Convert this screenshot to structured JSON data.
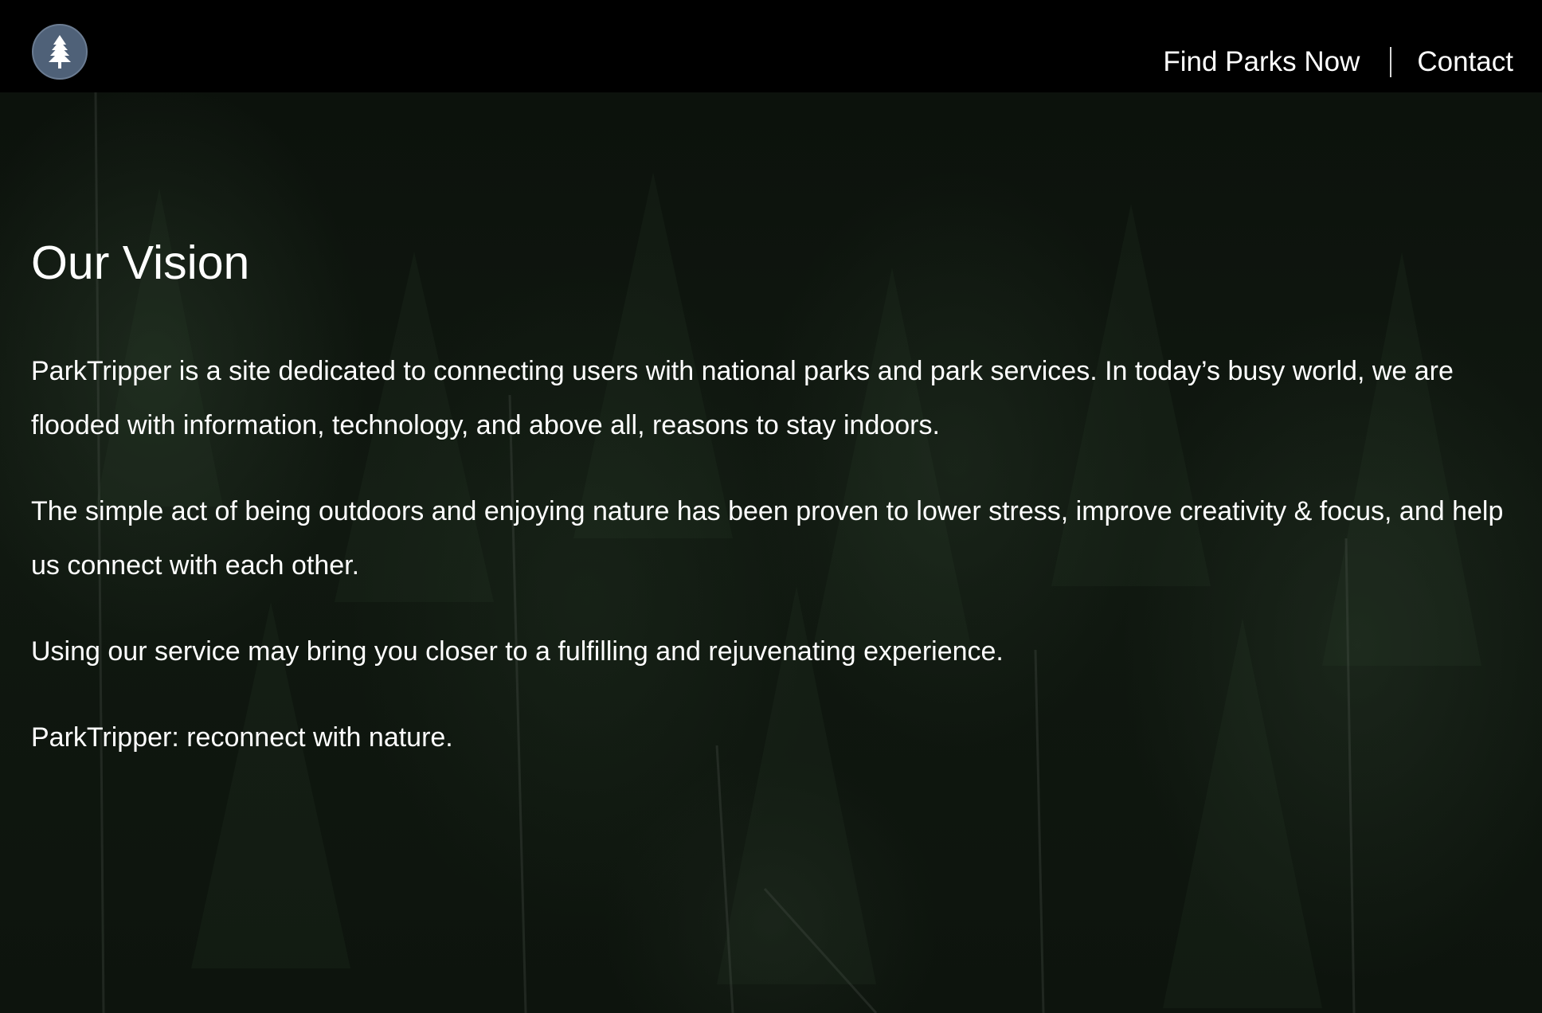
{
  "brand": {
    "logo_icon": "pine-tree-icon"
  },
  "nav": {
    "items": [
      {
        "label": "Find Parks Now"
      },
      {
        "label": "Contact"
      }
    ]
  },
  "main": {
    "title": "Our Vision",
    "paragraphs": [
      "ParkTripper is a site dedicated to connecting users with national parks and park services. In today’s busy world, we are flooded with information, technology, and above all, reasons to stay indoors.",
      "The simple act of being outdoors and enjoying nature has been proven to lower stress, improve creativity & focus, and help us connect with each other.",
      "Using our service may bring you closer to a fulfilling and rejuvenating experience.",
      "ParkTripper: reconnect with nature."
    ]
  },
  "colors": {
    "navbar_bg": "#000000",
    "text": "#ffffff",
    "logo_bg": "#4f6178",
    "forest_bg": "#0f170f"
  }
}
